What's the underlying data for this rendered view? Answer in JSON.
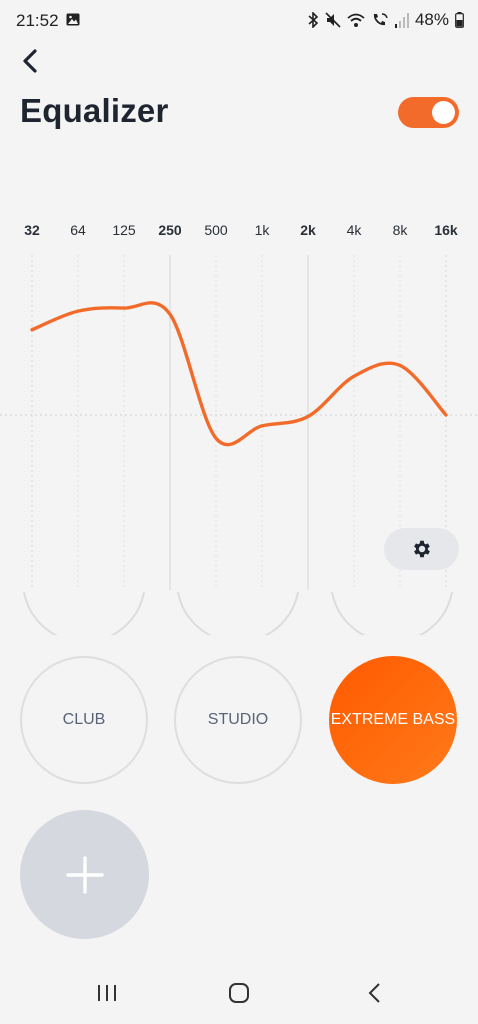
{
  "status_bar": {
    "time": "21:52",
    "battery": "48%",
    "icons": [
      "gallery-icon",
      "bluetooth-icon",
      "mute-icon",
      "wifi-icon",
      "wifi-call-icon",
      "signal-icon",
      "battery-icon"
    ]
  },
  "header": {
    "title": "Equalizer",
    "toggle_on": true
  },
  "equalizer": {
    "bands": [
      {
        "label": "32",
        "bold": true
      },
      {
        "label": "64",
        "bold": false
      },
      {
        "label": "125",
        "bold": false
      },
      {
        "label": "250",
        "bold": true
      },
      {
        "label": "500",
        "bold": false
      },
      {
        "label": "1k",
        "bold": false
      },
      {
        "label": "2k",
        "bold": true
      },
      {
        "label": "4k",
        "bold": false
      },
      {
        "label": "8k",
        "bold": false
      },
      {
        "label": "16k",
        "bold": true
      }
    ],
    "curve_levels": [
      0.55,
      0.67,
      0.69,
      0.65,
      -0.15,
      -0.07,
      -0.01,
      0.25,
      0.32,
      0.0
    ]
  },
  "presets": [
    {
      "label": "CLUB",
      "active": false
    },
    {
      "label": "STUDIO",
      "active": false
    },
    {
      "label": "EXTREME BASS",
      "active": true
    }
  ],
  "colors": {
    "accent": "#f26b2a",
    "accent_gradient_start": "#ff5a00",
    "accent_gradient_end": "#ff7a1a",
    "background": "#f4f4f4",
    "text": "#1f2530"
  },
  "icons": {
    "back": "chevron-left-icon",
    "settings": "gear-icon",
    "add": "plus-icon",
    "nav_recents": "recents-icon",
    "nav_home": "home-icon",
    "nav_back": "back-icon"
  }
}
